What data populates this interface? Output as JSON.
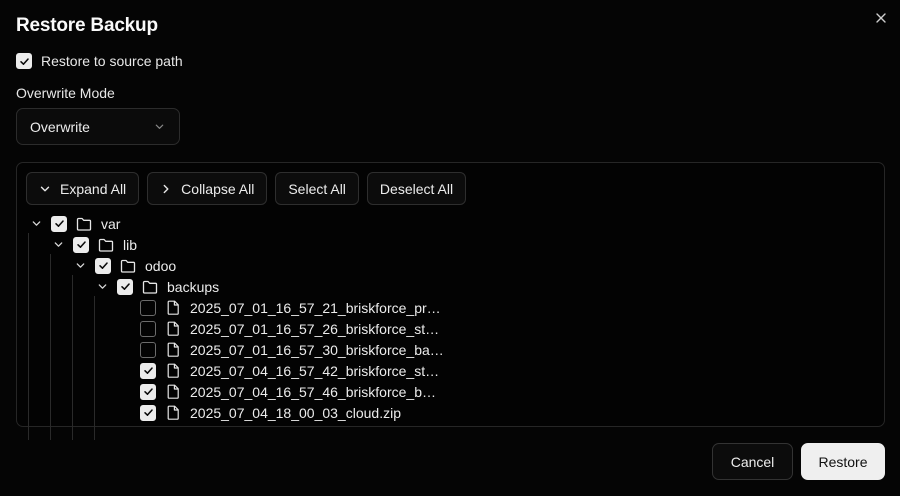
{
  "dialog": {
    "title": "Restore Backup",
    "restore_to_source": {
      "label": "Restore to source path",
      "checked": true
    },
    "overwrite_mode": {
      "label": "Overwrite Mode",
      "selected": "Overwrite"
    },
    "toolbar": {
      "expand_all": "Expand All",
      "collapse_all": "Collapse All",
      "select_all": "Select All",
      "deselect_all": "Deselect All"
    },
    "tree": [
      {
        "name": "var",
        "type": "folder",
        "checked": true
      },
      {
        "name": "lib",
        "type": "folder",
        "checked": true
      },
      {
        "name": "odoo",
        "type": "folder",
        "checked": true
      },
      {
        "name": "backups",
        "type": "folder",
        "checked": true
      },
      {
        "name": "2025_07_01_16_57_21_briskforce_pr…",
        "type": "file",
        "checked": false
      },
      {
        "name": "2025_07_01_16_57_26_briskforce_st…",
        "type": "file",
        "checked": false
      },
      {
        "name": "2025_07_01_16_57_30_briskforce_ba…",
        "type": "file",
        "checked": false
      },
      {
        "name": "2025_07_04_16_57_42_briskforce_st…",
        "type": "file",
        "checked": true
      },
      {
        "name": "2025_07_04_16_57_46_briskforce_b…",
        "type": "file",
        "checked": true
      },
      {
        "name": "2025_07_04_18_00_03_cloud.zip",
        "type": "file",
        "checked": true
      }
    ],
    "buttons": {
      "cancel": "Cancel",
      "restore": "Restore"
    }
  },
  "colors": {
    "background": "#050505",
    "primary_button": "#efefef",
    "border": "#2e2e2e"
  }
}
